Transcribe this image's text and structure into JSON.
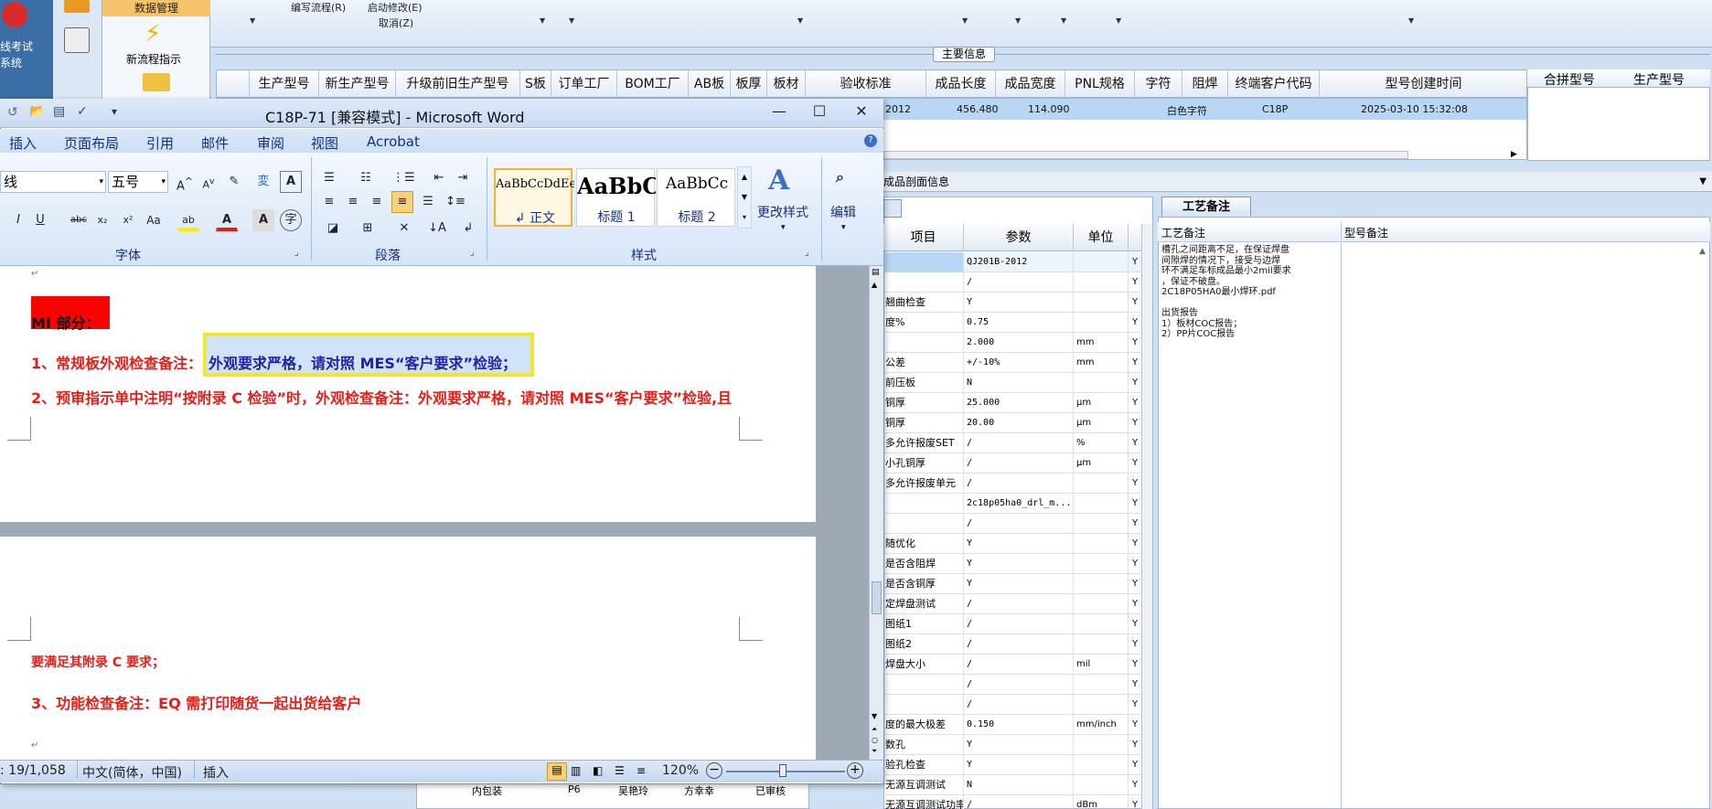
{
  "background_app": {
    "menu": {
      "edit_flow": "编写流程(R)",
      "start_modify": "启动修改(E)",
      "cancel": "取消(Z)"
    },
    "nav": {
      "login_text": "线考试",
      "system_text": "系统",
      "data_management": "数据管理",
      "new_flow_instruction": "新流程指示"
    },
    "main_info_tag": "主要信息",
    "grid_columns": [
      "生产型号",
      "新生产型号",
      "升级前旧生产型号",
      "S板",
      "订单工厂",
      "BOM工厂",
      "AB板",
      "板厚",
      "板材",
      "验收标准",
      "成品长度",
      "成品宽度",
      "PNL规格",
      "字符",
      "阻焊",
      "终端客户代码",
      "型号创建时间"
    ],
    "grid_row": {
      "accept_std": "2012",
      "length": "456.480",
      "width": "114.090",
      "char": "白色字符",
      "customer": "C18P",
      "created": "2025-03-10 15:32:08"
    },
    "right_columns": [
      "合拼型号",
      "生产型号"
    ],
    "section_title": "成品剖面信息",
    "params": {
      "tab": "",
      "columns": [
        "项目",
        "参数",
        "单位"
      ],
      "rows": [
        {
          "item": "",
          "param": "QJ201B-2012",
          "unit": "",
          "flag": "Y"
        },
        {
          "item": "",
          "param": "/",
          "unit": "",
          "flag": "Y"
        },
        {
          "item": "翘曲检查",
          "param": "Y",
          "unit": "",
          "flag": "Y"
        },
        {
          "item": "度%",
          "param": "0.75",
          "unit": "",
          "flag": "Y"
        },
        {
          "item": "",
          "param": "2.000",
          "unit": "mm",
          "flag": "Y"
        },
        {
          "item": "公差",
          "param": "+/-10%",
          "unit": "mm",
          "flag": "Y"
        },
        {
          "item": "前压板",
          "param": "N",
          "unit": "",
          "flag": "Y"
        },
        {
          "item": "铜厚",
          "param": "25.000",
          "unit": "μm",
          "flag": "Y"
        },
        {
          "item": "铜厚",
          "param": "20.00",
          "unit": "μm",
          "flag": "Y"
        },
        {
          "item": "多允许报废SET",
          "param": "/",
          "unit": "%",
          "flag": "Y"
        },
        {
          "item": "小孔铜厚",
          "param": "/",
          "unit": "μm",
          "flag": "Y"
        },
        {
          "item": "多允许报废单元",
          "param": "/",
          "unit": "",
          "flag": "Y"
        },
        {
          "item": "",
          "param": "2c18p05ha0_drl_m...",
          "unit": "",
          "flag": "Y"
        },
        {
          "item": "",
          "param": "/",
          "unit": "",
          "flag": "Y"
        },
        {
          "item": "随优化",
          "param": "Y",
          "unit": "",
          "flag": "Y"
        },
        {
          "item": "是否含阻焊",
          "param": "Y",
          "unit": "",
          "flag": "Y"
        },
        {
          "item": "是否含铜厚",
          "param": "Y",
          "unit": "",
          "flag": "Y"
        },
        {
          "item": "定焊盘测试",
          "param": "/",
          "unit": "",
          "flag": "Y"
        },
        {
          "item": "图纸1",
          "param": "/",
          "unit": "",
          "flag": "Y"
        },
        {
          "item": "图纸2",
          "param": "/",
          "unit": "",
          "flag": "Y"
        },
        {
          "item": "焊盘大小",
          "param": "/",
          "unit": "mil",
          "flag": "Y"
        },
        {
          "item": "",
          "param": "/",
          "unit": "",
          "flag": "Y"
        },
        {
          "item": "",
          "param": "/",
          "unit": "",
          "flag": "Y"
        },
        {
          "item": "度的最大极差",
          "param": "0.150",
          "unit": "mm/inch",
          "flag": "Y"
        },
        {
          "item": "数孔",
          "param": "Y",
          "unit": "",
          "flag": "Y"
        },
        {
          "item": "验孔检查",
          "param": "Y",
          "unit": "",
          "flag": "Y"
        },
        {
          "item": "无源互调测试",
          "param": "N",
          "unit": "",
          "flag": "Y"
        },
        {
          "item": "无源互调测试功率",
          "param": "/",
          "unit": "dBm",
          "flag": "Y"
        }
      ]
    },
    "process": {
      "tab": "工艺备注",
      "col1": "工艺备注",
      "col2": "型号备注",
      "text": "槽孔之间距离不足，在保证焊盘\n间隙焊的情况下，接受与边焊\n环不满足车标成品最小2mil要求\n，保证不破盘。\n2C18P05HA0最小焊环.pdf\n\n出货报告\n1）板材COC报告；\n2）PP片COC报告"
    },
    "bottom_list": [
      {
        "name": "内包装",
        "code": "P6",
        "person": "吴艳玲",
        "person2": "方幸幸",
        "status": "已审核"
      }
    ]
  },
  "word": {
    "title": "C18P-71 [兼容模式] - Microsoft Word",
    "tabs": [
      "插入",
      "页面布局",
      "引用",
      "邮件",
      "审阅",
      "视图",
      "Acrobat"
    ],
    "font_name": "线",
    "font_size": "五号",
    "groups": {
      "font": "字体",
      "paragraph": "段落",
      "styles": "样式"
    },
    "styles": [
      {
        "sample": "AaBbCcDdEe",
        "name": "↲ 正文"
      },
      {
        "sample": "AaBbC",
        "name": "标题 1"
      },
      {
        "sample": "AaBbCc",
        "name": "标题 2"
      }
    ],
    "change_styles": "更改样式",
    "edit": "编辑",
    "doc": {
      "heading": "MI 部分：",
      "line1_prefix": "1、常规板外观检查备注：",
      "line1_highlight": "外观要求严格，请对照 MES“客户要求”检验；",
      "line2": "2、预审指示单中注明“按附录 C 检验”时，外观检查备注：外观要求严格，请对照 MES“客户要求”检验,且",
      "line3": "要满足其附录 C 要求；",
      "line4": "3、功能检查备注：EQ 需打印随货一起出货给客户"
    },
    "status": {
      "page": ": 19/1,058",
      "lang": "中文(简体，中国)",
      "mode": "插入",
      "zoom": "120%"
    }
  }
}
